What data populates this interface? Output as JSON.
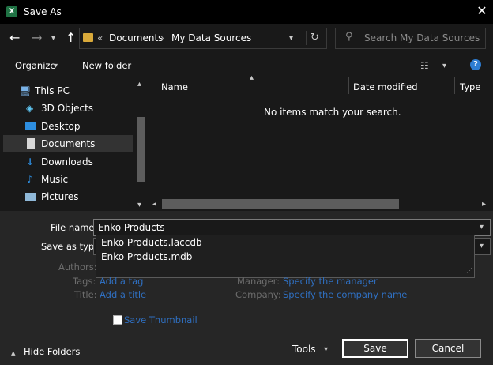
{
  "window": {
    "title": "Save As",
    "app_icon_letter": "X"
  },
  "address": {
    "overflow": "«",
    "crumbs": [
      "Documents",
      "My Data Sources"
    ]
  },
  "search": {
    "placeholder": "Search My Data Sources"
  },
  "toolbar": {
    "organize": "Organize",
    "new_folder": "New folder"
  },
  "nav": {
    "items": [
      {
        "label": "This PC",
        "icon": "computer-icon"
      },
      {
        "label": "3D Objects",
        "icon": "cube-icon"
      },
      {
        "label": "Desktop",
        "icon": "desktop-icon"
      },
      {
        "label": "Documents",
        "icon": "document-icon",
        "selected": true
      },
      {
        "label": "Downloads",
        "icon": "download-icon"
      },
      {
        "label": "Music",
        "icon": "music-icon"
      },
      {
        "label": "Pictures",
        "icon": "picture-icon"
      }
    ]
  },
  "columns": {
    "name": "Name",
    "date_modified": "Date modified",
    "type": "Type"
  },
  "content": {
    "empty_message": "No items match your search."
  },
  "form": {
    "file_name_label": "File name:",
    "file_name_value": "Enko Products",
    "save_as_type_label": "Save as type:",
    "suggestions": [
      "Enko Products.laccdb",
      "Enko Products.mdb"
    ],
    "authors_label": "Authors:",
    "tags_label": "Tags:",
    "tags_link": "Add a tag",
    "title_label": "Title:",
    "title_link": "Add a title",
    "manager_label": "Manager:",
    "manager_link": "Specify the manager",
    "company_label": "Company:",
    "company_link": "Specify the company name",
    "thumbnail_label": "Save Thumbnail"
  },
  "footer": {
    "hide_folders": "Hide Folders",
    "tools": "Tools",
    "save": "Save",
    "cancel": "Cancel"
  },
  "colors": {
    "accent": "#2d7dd2",
    "link": "#2f6fc0",
    "excel_green": "#1f7244"
  }
}
